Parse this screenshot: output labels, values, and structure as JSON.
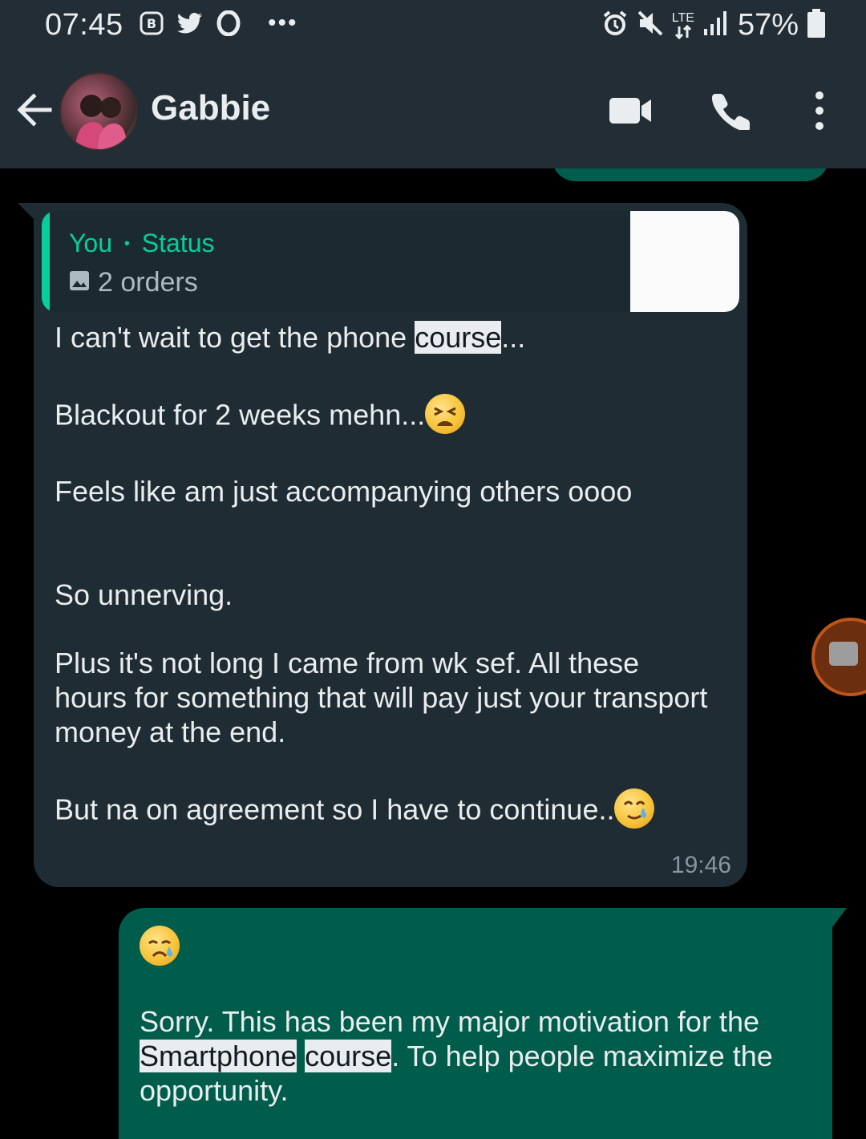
{
  "status_bar": {
    "time": "07:45",
    "left_icons": [
      "b-badge-icon",
      "twitter-icon",
      "opera-icon"
    ],
    "overflow": "•••",
    "network_label": "LTE",
    "battery_text": "57%"
  },
  "header": {
    "contact_name": "Gabbie"
  },
  "quote": {
    "author": "You",
    "separator": "•",
    "source": "Status",
    "subtitle": "2 orders"
  },
  "incoming": {
    "line1_pre": "I can't wait to get the phone ",
    "line1_hl": "course",
    "line1_post": "...",
    "line2": "Blackout for 2 weeks mehn...",
    "line3": "Feels like am just accompanying others oooo",
    "line4": "So unnerving.",
    "line5": "Plus it's not long I came from wk sef. All these",
    "line6": "hours for something that will pay just your transport",
    "line7": "money at the end.",
    "line8": "But na on agreement so I have to continue..",
    "time": "19:46"
  },
  "outgoing": {
    "line1": "Sorry. This has been my major motivation for the",
    "line2_hl1": "Smartphone",
    "line2_sp": " ",
    "line2_hl2": "course",
    "line2_post": ". To help people maximize the",
    "line3": "opportunity."
  }
}
